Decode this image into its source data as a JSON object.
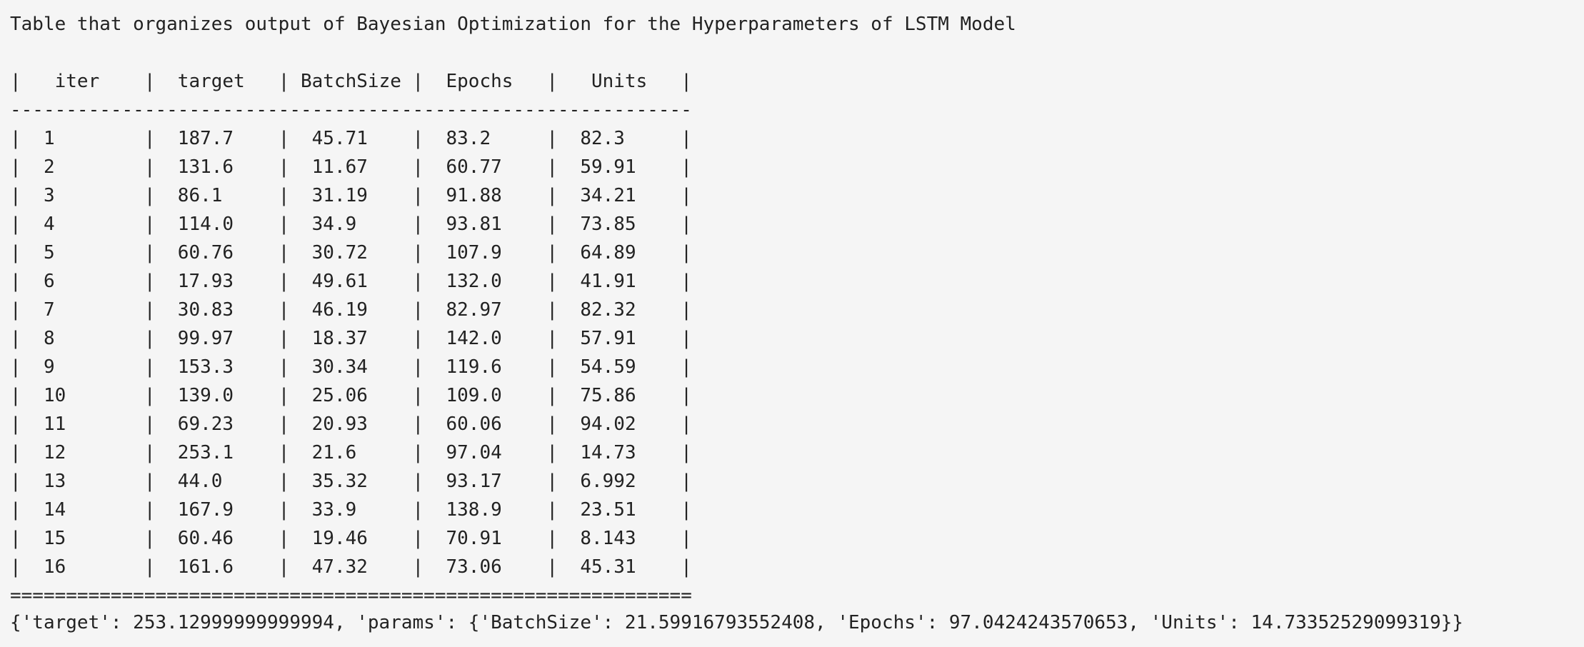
{
  "title": "Table that organizes output of Bayesian Optimization for the Hyperparameters of LSTM Model",
  "table": {
    "headers": [
      "iter",
      "target",
      "BatchSize",
      "Epochs",
      "Units"
    ],
    "rows": [
      [
        "1",
        "187.7",
        "45.71",
        "83.2",
        "82.3"
      ],
      [
        "2",
        "131.6",
        "11.67",
        "60.77",
        "59.91"
      ],
      [
        "3",
        "86.1",
        "31.19",
        "91.88",
        "34.21"
      ],
      [
        "4",
        "114.0",
        "34.9",
        "93.81",
        "73.85"
      ],
      [
        "5",
        "60.76",
        "30.72",
        "107.9",
        "64.89"
      ],
      [
        "6",
        "17.93",
        "49.61",
        "132.0",
        "41.91"
      ],
      [
        "7",
        "30.83",
        "46.19",
        "82.97",
        "82.32"
      ],
      [
        "8",
        "99.97",
        "18.37",
        "142.0",
        "57.91"
      ],
      [
        "9",
        "153.3",
        "30.34",
        "119.6",
        "54.59"
      ],
      [
        "10",
        "139.0",
        "25.06",
        "109.0",
        "75.86"
      ],
      [
        "11",
        "69.23",
        "20.93",
        "60.06",
        "94.02"
      ],
      [
        "12",
        "253.1",
        "21.6",
        "97.04",
        "14.73"
      ],
      [
        "13",
        "44.0",
        "35.32",
        "93.17",
        "6.992"
      ],
      [
        "14",
        "167.9",
        "33.9",
        "138.9",
        "23.51"
      ],
      [
        "15",
        "60.46",
        "19.46",
        "70.91",
        "8.143"
      ],
      [
        "16",
        "161.6",
        "47.32",
        "73.06",
        "45.31"
      ]
    ]
  },
  "result_line": "{'target': 253.12999999999994, 'params': {'BatchSize': 21.59916793552408, 'Epochs': 97.0424243570653, 'Units': 14.73352529099319}}"
}
